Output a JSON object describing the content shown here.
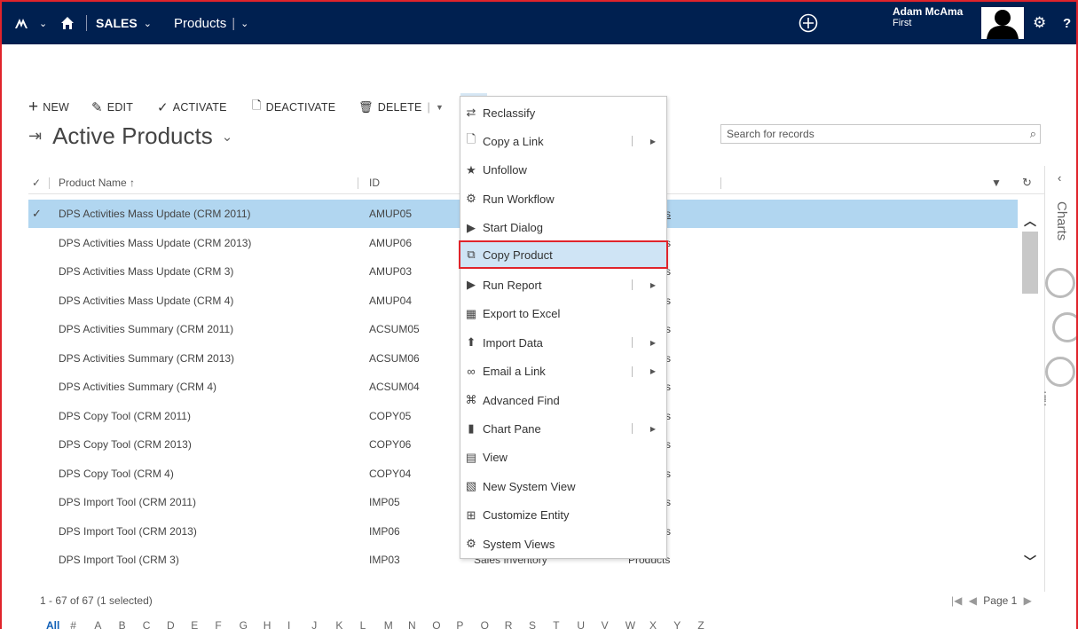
{
  "topbar": {
    "area": "SALES",
    "entity": "Products",
    "user_name": "Adam McAma",
    "user_org": "First"
  },
  "commands": {
    "new": "NEW",
    "edit": "EDIT",
    "activate": "ACTIVATE",
    "deactivate": "DEACTIVATE",
    "delete": "DELETE",
    "more": "•••"
  },
  "view": {
    "title": "Active Products",
    "search_placeholder": "Search for records"
  },
  "grid": {
    "columns": [
      "Product Name ↑",
      "ID"
    ],
    "rows": [
      {
        "name": "DPS Activities Mass Update (CRM 2011)",
        "id": "AMUP05",
        "tail": "s",
        "selected": true
      },
      {
        "name": "DPS Activities Mass Update (CRM 2013)",
        "id": "AMUP06",
        "tail": "s"
      },
      {
        "name": "DPS Activities Mass Update (CRM 3)",
        "id": "AMUP03",
        "tail": "s"
      },
      {
        "name": "DPS Activities Mass Update (CRM 4)",
        "id": "AMUP04",
        "tail": "s"
      },
      {
        "name": "DPS Activities Summary (CRM 2011)",
        "id": "ACSUM05",
        "tail": "s"
      },
      {
        "name": "DPS Activities Summary (CRM 2013)",
        "id": "ACSUM06",
        "tail": "s"
      },
      {
        "name": "DPS Activities Summary (CRM 4)",
        "id": "ACSUM04",
        "tail": "s"
      },
      {
        "name": "DPS Copy Tool (CRM 2011)",
        "id": "COPY05",
        "tail": "s"
      },
      {
        "name": "DPS Copy Tool (CRM 2013)",
        "id": "COPY06",
        "tail": "s"
      },
      {
        "name": "DPS Copy Tool (CRM 4)",
        "id": "COPY04",
        "tail": "s"
      },
      {
        "name": "DPS Import Tool (CRM 2011)",
        "id": "IMP05",
        "tail": "s"
      },
      {
        "name": "DPS Import Tool (CRM 2013)",
        "id": "IMP06",
        "tail": "s"
      },
      {
        "name": "DPS Import Tool (CRM 3)",
        "id": "IMP03",
        "unit": "Sales Inventory",
        "type": "Products"
      }
    ]
  },
  "menu": {
    "items": [
      {
        "label": "Reclassify",
        "icon": "reclassify-icon"
      },
      {
        "label": "Copy a Link",
        "icon": "page-icon",
        "submenu": true
      },
      {
        "label": "Unfollow",
        "icon": "star-icon"
      },
      {
        "label": "Run Workflow",
        "icon": "workflow-icon"
      },
      {
        "label": "Start Dialog",
        "icon": "dialog-icon"
      },
      {
        "label": "Copy Product",
        "icon": "copy-product-icon",
        "highlighted": true
      },
      {
        "label": "Run Report",
        "icon": "report-icon",
        "submenu": true
      },
      {
        "label": "Export to Excel",
        "icon": "excel-icon"
      },
      {
        "label": "Import Data",
        "icon": "import-icon",
        "submenu": true
      },
      {
        "label": "Email a Link",
        "icon": "link-icon",
        "submenu": true
      },
      {
        "label": "Advanced Find",
        "icon": "binoculars-icon"
      },
      {
        "label": "Chart Pane",
        "icon": "chart-icon",
        "submenu": true
      },
      {
        "label": "View",
        "icon": "view-icon"
      },
      {
        "label": "New System View",
        "icon": "new-view-icon"
      },
      {
        "label": "Customize Entity",
        "icon": "customize-icon"
      },
      {
        "label": "System Views",
        "icon": "gear-icon"
      }
    ]
  },
  "side": {
    "label": "Charts"
  },
  "footer": {
    "count": "1 - 67 of 67 (1 selected)",
    "page": "Page 1"
  },
  "alphabet": [
    "All",
    "#",
    "A",
    "B",
    "C",
    "D",
    "E",
    "F",
    "G",
    "H",
    "I",
    "J",
    "K",
    "L",
    "M",
    "N",
    "O",
    "P",
    "Q",
    "R",
    "S",
    "T",
    "U",
    "V",
    "W",
    "X",
    "Y",
    "Z"
  ],
  "colors": {
    "nav": "#002050",
    "selected_row": "#b1d6f0",
    "highlight": "#e0242b"
  }
}
